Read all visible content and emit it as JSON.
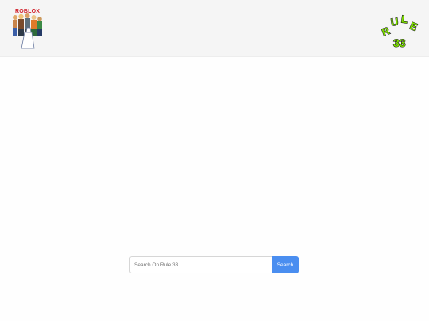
{
  "header": {
    "brand_logo": {
      "icon": "roblox-characters-logo",
      "wordmark": "ROBLOX"
    },
    "site_logo": {
      "icon": "rule-34-arc-logo",
      "letters": [
        "R",
        "U",
        "L",
        "E"
      ],
      "number": "33",
      "colors": {
        "fill": "#7ee000",
        "outline": "#111111"
      }
    }
  },
  "search": {
    "placeholder": "Search On Rule 33",
    "value": "",
    "button_label": "Search",
    "colors": {
      "button": "#4a8ef0"
    }
  }
}
